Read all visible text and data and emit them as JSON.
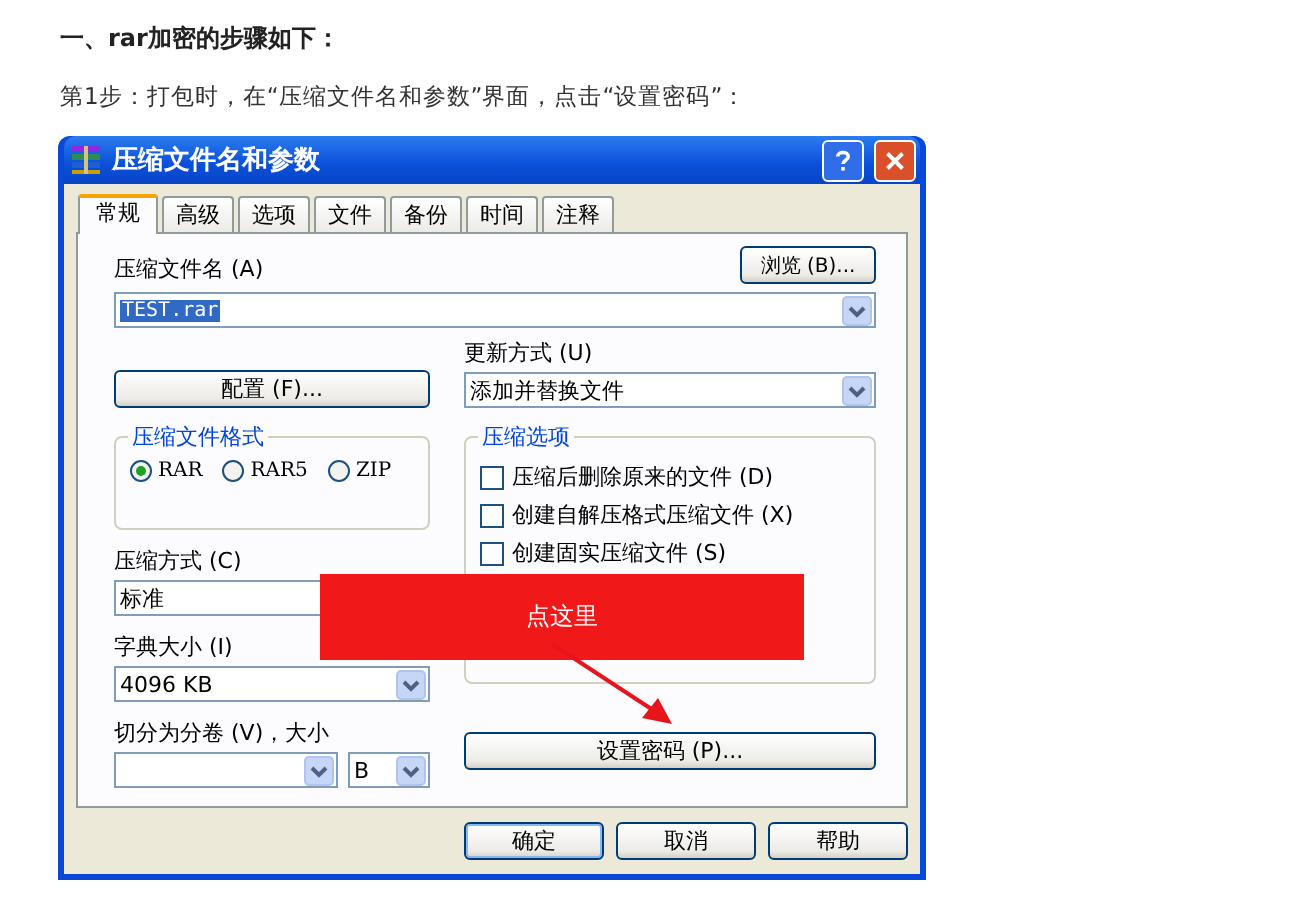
{
  "heading": "一、rar加密的步骤如下：",
  "instruction": "第1步：打包时，在“压缩文件名和参数”界面，点击“设置密码”：",
  "dialog": {
    "title": "压缩文件名和参数",
    "tabs": [
      {
        "label": "常规",
        "selected": true
      },
      {
        "label": "高级",
        "selected": false
      },
      {
        "label": "选项",
        "selected": false
      },
      {
        "label": "文件",
        "selected": false
      },
      {
        "label": "备份",
        "selected": false
      },
      {
        "label": "时间",
        "selected": false
      },
      {
        "label": "注释",
        "selected": false
      }
    ],
    "archive_name": {
      "label": "压缩文件名 (A)",
      "value": "TEST.rar",
      "browse_button": "浏览 (B)..."
    },
    "profiles_button": "配置 (F)...",
    "update_mode": {
      "label": "更新方式 (U)",
      "value": "添加并替换文件"
    },
    "archive_format": {
      "title": "压缩文件格式",
      "options": [
        {
          "label": "RAR",
          "selected": true
        },
        {
          "label": "RAR5",
          "selected": false
        },
        {
          "label": "ZIP",
          "selected": false
        }
      ]
    },
    "compression_method": {
      "label": "压缩方式 (C)",
      "value": "标准"
    },
    "dictionary_size": {
      "label": "字典大小 (I)",
      "value": "4096 KB"
    },
    "split": {
      "label": "切分为分卷 (V)，大小",
      "unit": "B"
    },
    "archiving_options": {
      "title": "压缩选项",
      "items": [
        {
          "label": "压缩后删除原来的文件 (D)",
          "checked": false
        },
        {
          "label": "创建自解压格式压缩文件 (X)",
          "checked": false
        },
        {
          "label": "创建固实压缩文件 (S)",
          "checked": false
        }
      ]
    },
    "set_password_button": "设置密码 (P)...",
    "buttons": [
      "确定",
      "取消",
      "帮助"
    ]
  },
  "callout": {
    "text": "点这里"
  }
}
